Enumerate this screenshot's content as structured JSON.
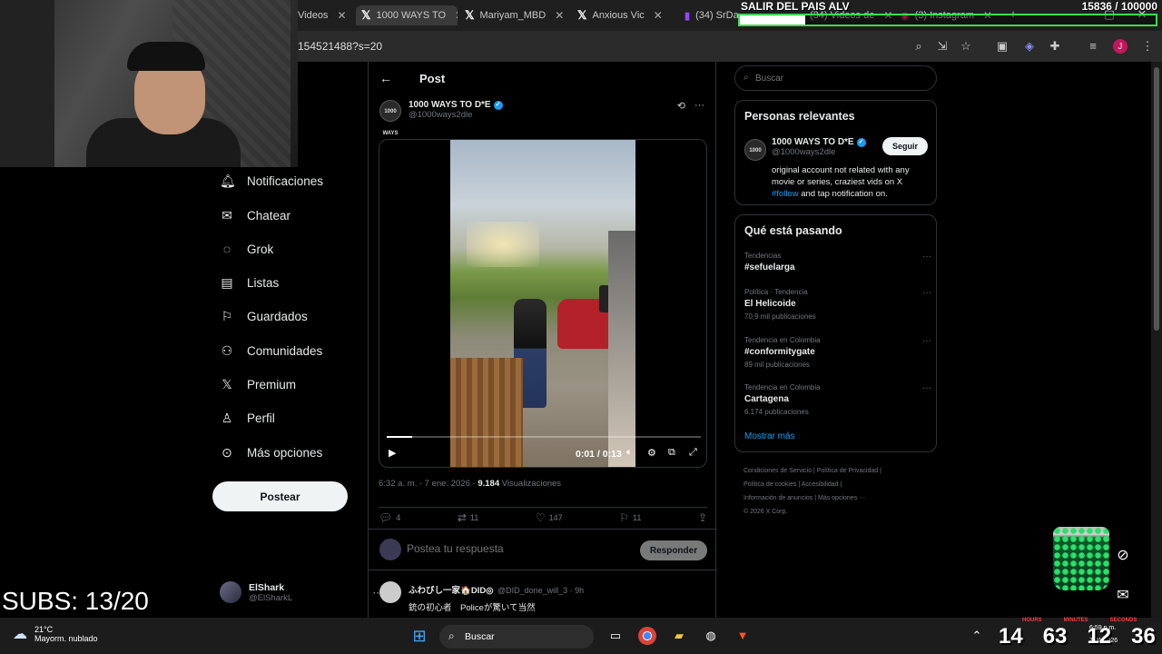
{
  "browser": {
    "tabs": [
      {
        "label": "Videos",
        "icon": "generic"
      },
      {
        "label": "1000 WAYS TO",
        "icon": "x-logo",
        "active": true
      },
      {
        "label": "Mariyam_MBD",
        "icon": "x-logo"
      },
      {
        "label": "Anxious Vic",
        "icon": "x-logo"
      },
      {
        "label": "(34) SrDa",
        "icon": "twitch"
      },
      {
        "label": "(34) Videos de",
        "icon": "generic"
      },
      {
        "label": "(3) Instagram",
        "icon": "instagram"
      }
    ],
    "url": "154521488?s=20",
    "profile_initial": "J"
  },
  "nav": {
    "items": [
      {
        "label": "Notificaciones",
        "icon": "bell-icon"
      },
      {
        "label": "Chatear",
        "icon": "mail-icon"
      },
      {
        "label": "Grok",
        "icon": "grok-icon"
      },
      {
        "label": "Listas",
        "icon": "list-icon"
      },
      {
        "label": "Guardados",
        "icon": "bookmark-icon"
      },
      {
        "label": "Comunidades",
        "icon": "communities-icon"
      },
      {
        "label": "Premium",
        "icon": "x-logo-icon"
      },
      {
        "label": "Perfil",
        "icon": "person-icon"
      },
      {
        "label": "Más opciones",
        "icon": "more-circle-icon"
      }
    ],
    "post_button": "Postear",
    "account": {
      "name": "ElShark",
      "handle": "@ElSharkL"
    }
  },
  "post": {
    "header": "Post",
    "author": {
      "name": "1000 WAYS TO D*E",
      "handle": "@1000ways2dle",
      "avatar_text": "1000 WAYS"
    },
    "video": {
      "time": "0:01 / 0:13",
      "progress": 0.08
    },
    "meta": {
      "time": "6:32 a. m. · 7 ene. 2026 · ",
      "views": "9.184",
      "views_label": " Visualizaciones"
    },
    "stats": {
      "replies": "4",
      "reposts": "11",
      "likes": "147",
      "bookmarks": "11"
    },
    "reply_placeholder": "Postea tu respuesta",
    "reply_button": "Responder",
    "reply_tweet": {
      "name": "ふわびし一家🏠DID◎",
      "handle": "@DID_done_will_3 · 9h",
      "text": "銃の初心者　Policeが驚いて当然"
    }
  },
  "sidebar": {
    "search_placeholder": "Buscar",
    "relevant_title": "Personas relevantes",
    "relevant": {
      "name": "1000 WAYS TO D*E",
      "handle": "@1000ways2dle",
      "follow": "Seguir",
      "bio_start": "original account not related with any movie or series, craziest vids on X ",
      "bio_link": "#follow",
      "bio_end": " and tap notification on."
    },
    "trends_title": "Qué está pasando",
    "trends": [
      {
        "meta": "Tendencias",
        "name": "#sefuelarga",
        "count": ""
      },
      {
        "meta": "Política · Tendencia",
        "name": "El Helicoide",
        "count": "70,9 mil publicaciones"
      },
      {
        "meta": "Tendencia en Colombia",
        "name": "#conformitygate",
        "count": "89 mil publicaciones"
      },
      {
        "meta": "Tendencia en Colombia",
        "name": "Cartagena",
        "count": "6.174 publicaciones"
      }
    ],
    "show_more": "Mostrar más",
    "footer": [
      "Condiciones de Servicio",
      "Política de Privacidad",
      "Política de cookies",
      "Accesibilidad",
      "Información de anuncios",
      "Más opciones ···",
      "© 2026 X Corp."
    ]
  },
  "stream": {
    "subs": "SUBS: 13/20",
    "goal_title": "SALIR DEL PAIS ALV",
    "goal_count": "15836   / 100000",
    "goal_progress": 0.158,
    "clock": {
      "h": "14",
      "m": "63",
      "s": "12",
      "x": "36"
    },
    "clock_labels": [
      "HOURS",
      "MINUTES",
      "SECONDS"
    ]
  },
  "taskbar": {
    "weather_temp": "21°C",
    "weather_desc": "Mayorm. nublado",
    "search_label": "Buscar",
    "time": "6:59 p.m.",
    "date": "7/01/2026"
  }
}
